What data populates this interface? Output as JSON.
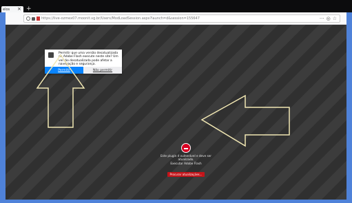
{
  "browser": {
    "tab_title": "elos",
    "tab_close": "×",
    "new_tab": "+",
    "url": "https://live-ozmex07.moonit.vg.br/Users/ModLoadSession.aspx?launch=d&session=155647",
    "toolbar_icons": [
      "page-actions-icon",
      "pocket-icon",
      "bookmark-star-icon"
    ],
    "toolbar_glyphs": [
      "···",
      "◎",
      "☆"
    ]
  },
  "flash_prompt": {
    "message": "Permitir que uma versão desatualizada do Adobe Flash execute neste site? Um versão desatualizada pode afetar a navegação e segurança.",
    "allow_label": "Permitir",
    "deny_label": "Não permitir"
  },
  "plugin_blocked": {
    "message_line1": "Este plugin é vulnerável e deve ser atualizado.",
    "message_line2": "Executar Adobe Flash",
    "update_label": "Procurar atualizações..."
  },
  "colors": {
    "frame": "#4f82d9",
    "allow_button": "#0a84ff",
    "blocked_icon": "#d70022",
    "update_button": "#c4141a",
    "arrow_stroke": "#f1e7b3"
  }
}
